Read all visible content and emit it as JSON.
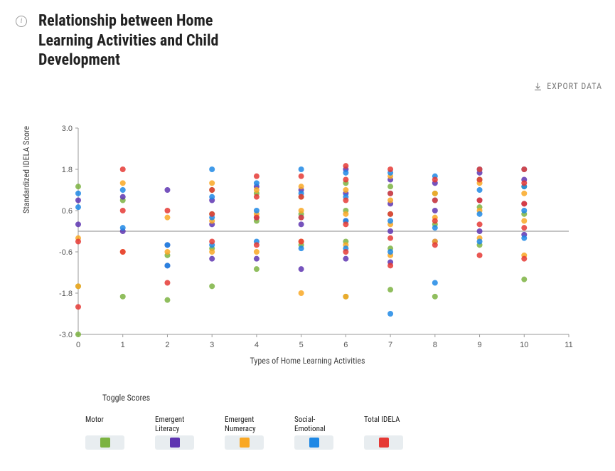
{
  "title": "Relationship between Home Learning Activities and Child Development",
  "export_label": "EXPORT DATA",
  "legend_title": "Toggle Scores",
  "axis": {
    "x_label": "Types of Home Learning Activities",
    "y_label": "Standardized IDELA Score"
  },
  "chart_data": {
    "type": "scatter",
    "xlabel": "Types of Home Learning Activities",
    "ylabel": "Standardized IDELA Score",
    "xlim": [
      0,
      11
    ],
    "ylim": [
      -3.0,
      3.0
    ],
    "x_ticks": [
      0,
      1,
      2,
      3,
      4,
      5,
      6,
      7,
      8,
      9,
      10,
      11
    ],
    "y_ticks": [
      -3.0,
      -1.8,
      -0.6,
      0.6,
      1.8,
      3.0
    ],
    "reference_line_y": 0.0,
    "grid": false,
    "legend_position": "bottom",
    "series": [
      {
        "name": "Motor",
        "color": "#7cb342",
        "points": [
          {
            "x": 0,
            "y": -3.0
          },
          {
            "x": 0,
            "y": -1.6
          },
          {
            "x": 0,
            "y": 1.3
          },
          {
            "x": 1,
            "y": -1.9
          },
          {
            "x": 1,
            "y": 0.9
          },
          {
            "x": 2,
            "y": -2.0
          },
          {
            "x": 2,
            "y": -0.7
          },
          {
            "x": 3,
            "y": -1.6
          },
          {
            "x": 3,
            "y": -0.5
          },
          {
            "x": 3,
            "y": 0.5
          },
          {
            "x": 3,
            "y": 1.2
          },
          {
            "x": 4,
            "y": -1.1
          },
          {
            "x": 4,
            "y": 0.3
          },
          {
            "x": 4,
            "y": 1.1
          },
          {
            "x": 5,
            "y": -0.4
          },
          {
            "x": 5,
            "y": 0.5
          },
          {
            "x": 5,
            "y": 1.0
          },
          {
            "x": 6,
            "y": -1.9
          },
          {
            "x": 6,
            "y": -0.3
          },
          {
            "x": 6,
            "y": 0.6
          },
          {
            "x": 6,
            "y": 1.4
          },
          {
            "x": 7,
            "y": -1.7
          },
          {
            "x": 7,
            "y": -0.5
          },
          {
            "x": 7,
            "y": 0.5
          },
          {
            "x": 7,
            "y": 1.3
          },
          {
            "x": 8,
            "y": -1.9
          },
          {
            "x": 8,
            "y": 0.2
          },
          {
            "x": 8,
            "y": 1.1
          },
          {
            "x": 9,
            "y": -0.4
          },
          {
            "x": 9,
            "y": 0.7
          },
          {
            "x": 9,
            "y": 1.5
          },
          {
            "x": 10,
            "y": -1.4
          },
          {
            "x": 10,
            "y": 0.5
          },
          {
            "x": 10,
            "y": 1.3
          }
        ]
      },
      {
        "name": "Emergent Literacy",
        "color": "#5e35b1",
        "points": [
          {
            "x": 0,
            "y": 0.2
          },
          {
            "x": 0,
            "y": 0.9
          },
          {
            "x": 1,
            "y": 0.0
          },
          {
            "x": 1,
            "y": 1.0
          },
          {
            "x": 2,
            "y": -1.0
          },
          {
            "x": 2,
            "y": -0.4
          },
          {
            "x": 2,
            "y": 1.2
          },
          {
            "x": 3,
            "y": -0.8
          },
          {
            "x": 3,
            "y": 0.2
          },
          {
            "x": 3,
            "y": 0.9
          },
          {
            "x": 4,
            "y": -0.8
          },
          {
            "x": 4,
            "y": 0.4
          },
          {
            "x": 4,
            "y": 1.3
          },
          {
            "x": 5,
            "y": -1.1
          },
          {
            "x": 5,
            "y": 0.2
          },
          {
            "x": 5,
            "y": 1.2
          },
          {
            "x": 6,
            "y": -0.8
          },
          {
            "x": 6,
            "y": 0.3
          },
          {
            "x": 6,
            "y": 1.1
          },
          {
            "x": 6,
            "y": 1.8
          },
          {
            "x": 7,
            "y": -0.9
          },
          {
            "x": 7,
            "y": 0.0
          },
          {
            "x": 7,
            "y": 0.8
          },
          {
            "x": 7,
            "y": 1.5
          },
          {
            "x": 8,
            "y": -0.3
          },
          {
            "x": 8,
            "y": 0.6
          },
          {
            "x": 8,
            "y": 1.4
          },
          {
            "x": 9,
            "y": 0.0
          },
          {
            "x": 9,
            "y": 0.9
          },
          {
            "x": 9,
            "y": 1.7
          },
          {
            "x": 10,
            "y": -0.1
          },
          {
            "x": 10,
            "y": 0.8
          },
          {
            "x": 10,
            "y": 1.5
          }
        ]
      },
      {
        "name": "Emergent Numeracy",
        "color": "#f9a825",
        "points": [
          {
            "x": 0,
            "y": -1.6
          },
          {
            "x": 0,
            "y": -0.2
          },
          {
            "x": 1,
            "y": -0.6
          },
          {
            "x": 1,
            "y": 1.4
          },
          {
            "x": 2,
            "y": -0.6
          },
          {
            "x": 2,
            "y": 0.4
          },
          {
            "x": 3,
            "y": -0.6
          },
          {
            "x": 3,
            "y": 0.3
          },
          {
            "x": 3,
            "y": 1.4
          },
          {
            "x": 4,
            "y": -0.6
          },
          {
            "x": 4,
            "y": 0.5
          },
          {
            "x": 4,
            "y": 1.2
          },
          {
            "x": 5,
            "y": -1.8
          },
          {
            "x": 5,
            "y": -0.3
          },
          {
            "x": 5,
            "y": 0.6
          },
          {
            "x": 5,
            "y": 1.3
          },
          {
            "x": 6,
            "y": -1.9
          },
          {
            "x": 6,
            "y": -0.4
          },
          {
            "x": 6,
            "y": 0.5
          },
          {
            "x": 6,
            "y": 1.2
          },
          {
            "x": 7,
            "y": -0.7
          },
          {
            "x": 7,
            "y": 0.2
          },
          {
            "x": 7,
            "y": 0.9
          },
          {
            "x": 7,
            "y": 1.6
          },
          {
            "x": 8,
            "y": -0.3
          },
          {
            "x": 8,
            "y": 0.4
          },
          {
            "x": 8,
            "y": 1.1
          },
          {
            "x": 9,
            "y": -0.2
          },
          {
            "x": 9,
            "y": 0.6
          },
          {
            "x": 9,
            "y": 1.4
          },
          {
            "x": 10,
            "y": -0.7
          },
          {
            "x": 10,
            "y": 0.3
          },
          {
            "x": 10,
            "y": 1.1
          }
        ]
      },
      {
        "name": "Social-Emotional",
        "color": "#1e88e5",
        "points": [
          {
            "x": 0,
            "y": 0.7
          },
          {
            "x": 0,
            "y": 1.1
          },
          {
            "x": 1,
            "y": 0.1
          },
          {
            "x": 1,
            "y": 1.2
          },
          {
            "x": 2,
            "y": -1.0
          },
          {
            "x": 2,
            "y": -0.4
          },
          {
            "x": 3,
            "y": -0.4
          },
          {
            "x": 3,
            "y": 0.4
          },
          {
            "x": 3,
            "y": 1.0
          },
          {
            "x": 3,
            "y": 1.8
          },
          {
            "x": 4,
            "y": -0.3
          },
          {
            "x": 4,
            "y": 0.6
          },
          {
            "x": 4,
            "y": 1.4
          },
          {
            "x": 5,
            "y": -0.5
          },
          {
            "x": 5,
            "y": 0.4
          },
          {
            "x": 5,
            "y": 1.1
          },
          {
            "x": 5,
            "y": 1.8
          },
          {
            "x": 6,
            "y": -0.5
          },
          {
            "x": 6,
            "y": 0.3
          },
          {
            "x": 6,
            "y": 1.0
          },
          {
            "x": 6,
            "y": 1.7
          },
          {
            "x": 7,
            "y": -2.4
          },
          {
            "x": 7,
            "y": -0.6
          },
          {
            "x": 7,
            "y": 0.3
          },
          {
            "x": 7,
            "y": 1.1
          },
          {
            "x": 7,
            "y": 1.7
          },
          {
            "x": 8,
            "y": -1.5
          },
          {
            "x": 8,
            "y": 0.1
          },
          {
            "x": 8,
            "y": 0.9
          },
          {
            "x": 8,
            "y": 1.6
          },
          {
            "x": 9,
            "y": -0.3
          },
          {
            "x": 9,
            "y": 0.5
          },
          {
            "x": 9,
            "y": 1.2
          },
          {
            "x": 9,
            "y": 1.8
          },
          {
            "x": 10,
            "y": -0.2
          },
          {
            "x": 10,
            "y": 0.6
          },
          {
            "x": 10,
            "y": 1.3
          },
          {
            "x": 10,
            "y": 1.8
          }
        ]
      },
      {
        "name": "Total IDELA",
        "color": "#e53935",
        "points": [
          {
            "x": 0,
            "y": -2.2
          },
          {
            "x": 0,
            "y": -0.3
          },
          {
            "x": 1,
            "y": -0.6
          },
          {
            "x": 1,
            "y": 0.6
          },
          {
            "x": 1,
            "y": 1.8
          },
          {
            "x": 2,
            "y": -1.5
          },
          {
            "x": 2,
            "y": 0.6
          },
          {
            "x": 3,
            "y": -0.3
          },
          {
            "x": 3,
            "y": 0.5
          },
          {
            "x": 3,
            "y": 1.2
          },
          {
            "x": 4,
            "y": -0.4
          },
          {
            "x": 4,
            "y": 0.4
          },
          {
            "x": 4,
            "y": 1.0
          },
          {
            "x": 4,
            "y": 1.6
          },
          {
            "x": 5,
            "y": -0.3
          },
          {
            "x": 5,
            "y": 0.4
          },
          {
            "x": 5,
            "y": 1.0
          },
          {
            "x": 5,
            "y": 1.6
          },
          {
            "x": 6,
            "y": -0.6
          },
          {
            "x": 6,
            "y": 0.2
          },
          {
            "x": 6,
            "y": 0.9
          },
          {
            "x": 6,
            "y": 1.5
          },
          {
            "x": 6,
            "y": 1.9
          },
          {
            "x": 7,
            "y": -1.0
          },
          {
            "x": 7,
            "y": -0.2
          },
          {
            "x": 7,
            "y": 0.5
          },
          {
            "x": 7,
            "y": 1.1
          },
          {
            "x": 7,
            "y": 1.8
          },
          {
            "x": 8,
            "y": -0.4
          },
          {
            "x": 8,
            "y": 0.3
          },
          {
            "x": 8,
            "y": 0.9
          },
          {
            "x": 8,
            "y": 1.5
          },
          {
            "x": 9,
            "y": -0.7
          },
          {
            "x": 9,
            "y": 0.2
          },
          {
            "x": 9,
            "y": 0.9
          },
          {
            "x": 9,
            "y": 1.5
          },
          {
            "x": 9,
            "y": 1.8
          },
          {
            "x": 10,
            "y": -0.8
          },
          {
            "x": 10,
            "y": 0.1
          },
          {
            "x": 10,
            "y": 0.8
          },
          {
            "x": 10,
            "y": 1.4
          },
          {
            "x": 10,
            "y": 1.8
          }
        ]
      }
    ]
  },
  "legend": [
    {
      "label": "Motor",
      "color": "#7cb342"
    },
    {
      "label": "Emergent Literacy",
      "color": "#5e35b1"
    },
    {
      "label": "Emergent Numeracy",
      "color": "#f9a825"
    },
    {
      "label": "Social-Emotional",
      "color": "#1e88e5"
    },
    {
      "label": "Total IDELA",
      "color": "#e53935"
    }
  ]
}
